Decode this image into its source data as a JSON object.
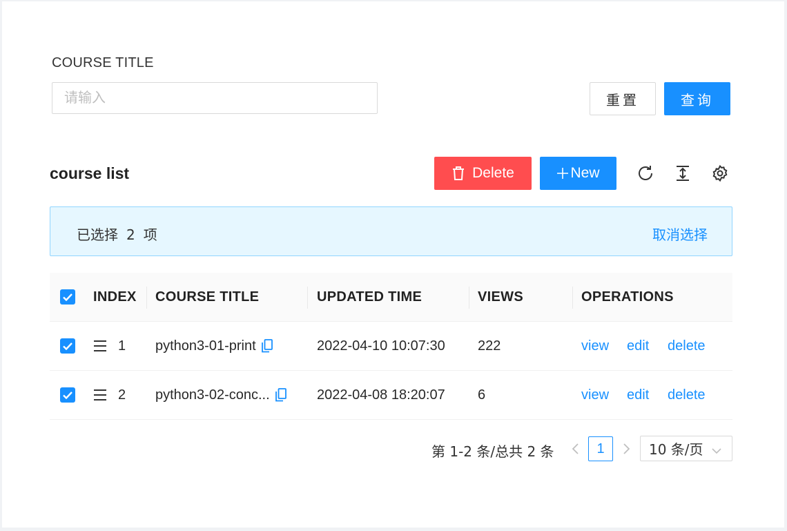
{
  "search": {
    "label": "COURSE TITLE",
    "placeholder": "请输入",
    "reset_label": "重置",
    "query_label": "查询"
  },
  "toolbar": {
    "title": "course list",
    "delete_label": "Delete",
    "new_label": "New",
    "icons": [
      "reload-icon",
      "column-height-icon",
      "setting-icon"
    ]
  },
  "alert": {
    "prefix": "已选择",
    "count": "2",
    "suffix": "项",
    "cancel_label": "取消选择"
  },
  "table": {
    "columns": [
      "INDEX",
      "COURSE TITLE",
      "UPDATED TIME",
      "VIEWS",
      "OPERATIONS"
    ],
    "rows": [
      {
        "index": "1",
        "title": "python3-01-print",
        "updated": "2022-04-10 10:07:30",
        "views": "222",
        "selected": true
      },
      {
        "index": "2",
        "title": "python3-02-conc...",
        "updated": "2022-04-08 18:20:07",
        "views": "6",
        "selected": true
      }
    ],
    "operations": {
      "view": "view",
      "edit": "edit",
      "delete": "delete"
    }
  },
  "pagination": {
    "total_text": "第 1-2 条/总共 2 条",
    "current_page": "1",
    "page_size": "10 条/页"
  },
  "colors": {
    "primary": "#1890ff",
    "danger": "#ff4d4f",
    "alert_bg": "#e6f7ff",
    "alert_border": "#91d5ff"
  }
}
